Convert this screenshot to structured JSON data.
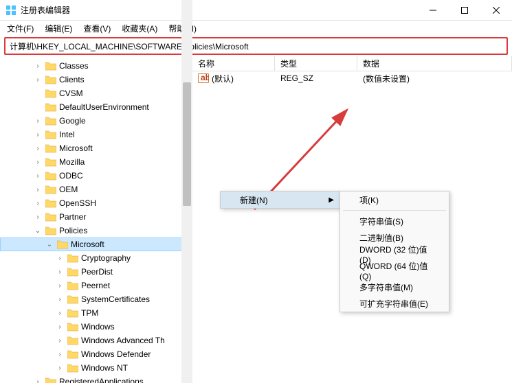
{
  "window": {
    "title": "注册表编辑器"
  },
  "menubar": {
    "file": "文件(F)",
    "edit": "编辑(E)",
    "view": "查看(V)",
    "favorites": "收藏夹(A)",
    "help": "帮助(H)"
  },
  "address": "计算机\\HKEY_LOCAL_MACHINE\\SOFTWARE\\Policies\\Microsoft",
  "tree": [
    {
      "label": "Classes",
      "indent": 3,
      "exp": ">"
    },
    {
      "label": "Clients",
      "indent": 3,
      "exp": ">"
    },
    {
      "label": "CVSM",
      "indent": 3,
      "exp": ""
    },
    {
      "label": "DefaultUserEnvironment",
      "indent": 3,
      "exp": ""
    },
    {
      "label": "Google",
      "indent": 3,
      "exp": ">"
    },
    {
      "label": "Intel",
      "indent": 3,
      "exp": ">"
    },
    {
      "label": "Microsoft",
      "indent": 3,
      "exp": ">"
    },
    {
      "label": "Mozilla",
      "indent": 3,
      "exp": ">"
    },
    {
      "label": "ODBC",
      "indent": 3,
      "exp": ">"
    },
    {
      "label": "OEM",
      "indent": 3,
      "exp": ">"
    },
    {
      "label": "OpenSSH",
      "indent": 3,
      "exp": ">"
    },
    {
      "label": "Partner",
      "indent": 3,
      "exp": ">"
    },
    {
      "label": "Policies",
      "indent": 3,
      "exp": "v"
    },
    {
      "label": "Microsoft",
      "indent": 4,
      "exp": "v",
      "selected": true
    },
    {
      "label": "Cryptography",
      "indent": 5,
      "exp": ">"
    },
    {
      "label": "PeerDist",
      "indent": 5,
      "exp": ">"
    },
    {
      "label": "Peernet",
      "indent": 5,
      "exp": ">"
    },
    {
      "label": "SystemCertificates",
      "indent": 5,
      "exp": ">"
    },
    {
      "label": "TPM",
      "indent": 5,
      "exp": ">"
    },
    {
      "label": "Windows",
      "indent": 5,
      "exp": ">"
    },
    {
      "label": "Windows Advanced Th",
      "indent": 5,
      "exp": ">"
    },
    {
      "label": "Windows Defender",
      "indent": 5,
      "exp": ">"
    },
    {
      "label": "Windows NT",
      "indent": 5,
      "exp": ">"
    },
    {
      "label": "RegisteredApplications",
      "indent": 3,
      "exp": ">"
    }
  ],
  "list": {
    "headers": {
      "name": "名称",
      "type": "类型",
      "data": "数据"
    },
    "rows": [
      {
        "name": "(默认)",
        "type": "REG_SZ",
        "data": "(数值未设置)"
      }
    ]
  },
  "context": {
    "parent": {
      "new": "新建(N)"
    },
    "sub": {
      "key": "项(K)",
      "string": "字符串值(S)",
      "binary": "二进制值(B)",
      "dword": "DWORD (32 位)值(D)",
      "qword": "QWORD (64 位)值(Q)",
      "multi": "多字符串值(M)",
      "expand": "可扩充字符串值(E)"
    }
  }
}
